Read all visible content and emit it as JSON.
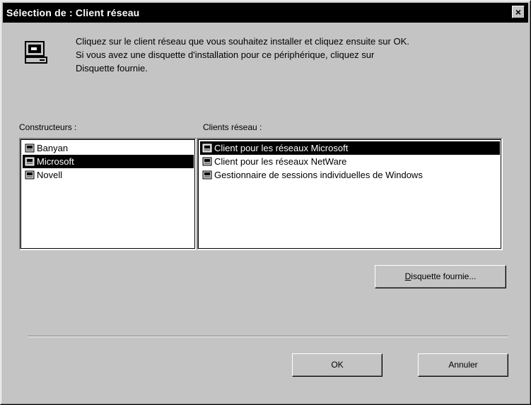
{
  "window": {
    "title": "Sélection de : Client réseau",
    "close_glyph": "×"
  },
  "instructions": "Cliquez sur le client réseau que vous souhaitez installer et cliquez ensuite sur OK.\nSi vous avez une disquette d'installation pour ce périphérique, cliquez sur\nDisquette fournie.",
  "manufacturers": {
    "label": "Constructeurs :",
    "items": [
      {
        "label": "Banyan",
        "selected": false,
        "icon": "network-component-icon"
      },
      {
        "label": "Microsoft",
        "selected": true,
        "icon": "network-component-icon"
      },
      {
        "label": "Novell",
        "selected": false,
        "icon": "network-component-icon"
      }
    ]
  },
  "clients": {
    "label": "Clients réseau :",
    "items": [
      {
        "label": "Client pour les réseaux Microsoft",
        "selected": true,
        "icon": "network-component-icon"
      },
      {
        "label": "Client pour les réseaux NetWare",
        "selected": false,
        "icon": "network-component-icon"
      },
      {
        "label": "Gestionnaire de sessions individuelles de Windows",
        "selected": false,
        "icon": "network-component-icon"
      }
    ]
  },
  "buttons": {
    "have_disk_first": "D",
    "have_disk_rest": "isquette fournie...",
    "ok": "OK",
    "cancel": "Annuler"
  },
  "colors": {
    "face": "#c4c4c4",
    "title_bar": "#000000",
    "selection": "#000000"
  }
}
